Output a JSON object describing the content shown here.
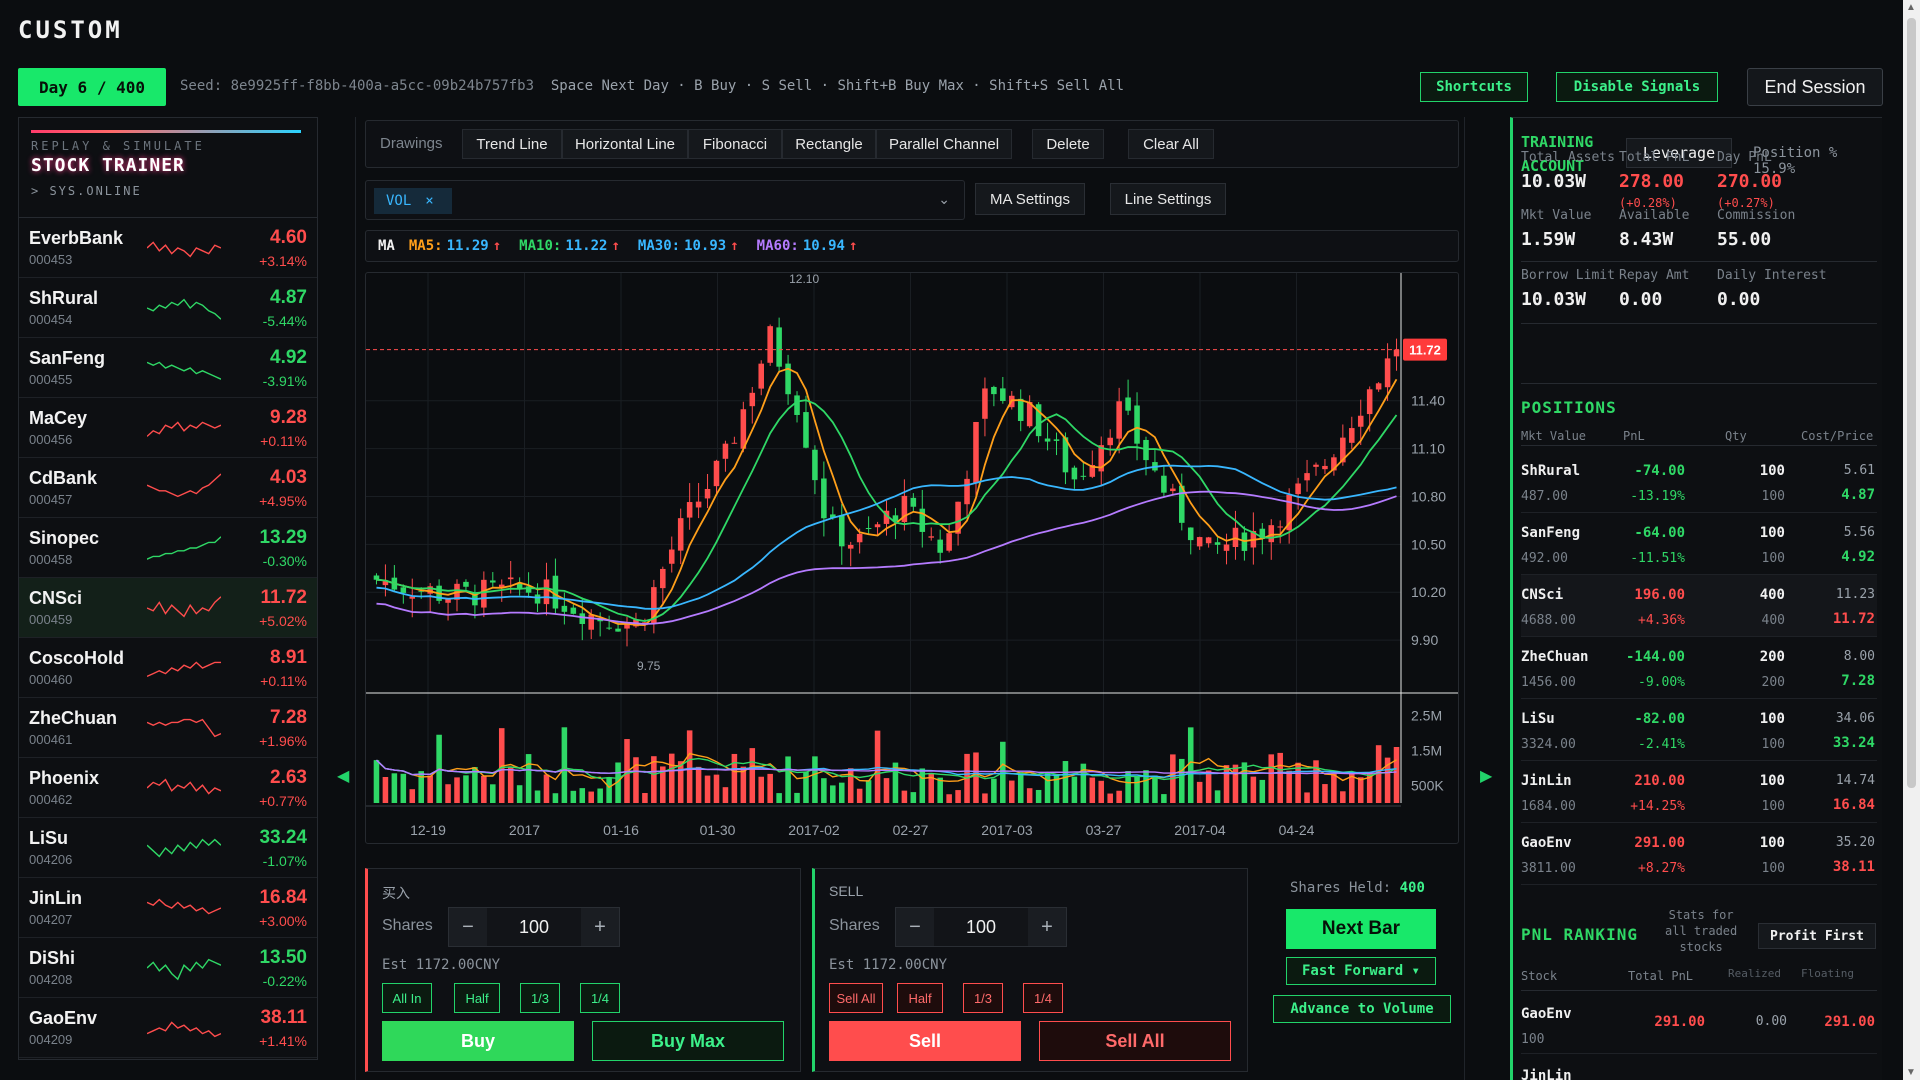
{
  "app": {
    "brand": "CUSTOM",
    "day": "Day 6 / 400",
    "seed": "Seed: 8e9925ff-f8bb-400a-a5cc-09b24b757fb3",
    "hotkeys": "Space Next Day · B Buy · S Sell · Shift+B Buy Max · Shift+S Sell All",
    "shortcuts": "Shortcuts",
    "disable_signals": "Disable Signals",
    "end_session": "End Session"
  },
  "sidebar": {
    "subtitle": "REPLAY & SIMULATE",
    "title": "STOCK TRAINER",
    "status": "> SYS.ONLINE",
    "stocks": [
      {
        "name": "EverbBank",
        "code": "000453",
        "price": "4.60",
        "change": "+3.14%",
        "dir": "up",
        "spark": [
          0.5,
          0.3,
          0.6,
          0.4,
          0.7,
          0.5,
          0.6,
          0.8,
          0.5,
          0.6,
          0.7,
          0.4,
          0.5
        ]
      },
      {
        "name": "ShRural",
        "code": "000454",
        "price": "4.87",
        "change": "-5.44%",
        "dir": "dn",
        "spark": [
          0.5,
          0.6,
          0.4,
          0.5,
          0.3,
          0.4,
          0.2,
          0.5,
          0.3,
          0.4,
          0.6,
          0.7,
          0.9
        ]
      },
      {
        "name": "SanFeng",
        "code": "000455",
        "price": "4.92",
        "change": "-3.91%",
        "dir": "dn",
        "spark": [
          0.3,
          0.4,
          0.3,
          0.5,
          0.4,
          0.5,
          0.6,
          0.5,
          0.7,
          0.6,
          0.7,
          0.8,
          0.9
        ]
      },
      {
        "name": "MaCey",
        "code": "000456",
        "price": "9.28",
        "change": "+0.11%",
        "dir": "up",
        "spark": [
          0.8,
          0.6,
          0.7,
          0.4,
          0.5,
          0.3,
          0.6,
          0.4,
          0.5,
          0.3,
          0.4,
          0.5,
          0.4
        ]
      },
      {
        "name": "CdBank",
        "code": "000457",
        "price": "4.03",
        "change": "+4.95%",
        "dir": "up",
        "spark": [
          0.4,
          0.5,
          0.6,
          0.6,
          0.7,
          0.8,
          0.7,
          0.6,
          0.7,
          0.5,
          0.4,
          0.2,
          0.0
        ]
      },
      {
        "name": "Sinopec",
        "code": "000458",
        "price": "13.29",
        "change": "-0.30%",
        "dir": "dn",
        "spark": [
          0.9,
          0.8,
          0.8,
          0.7,
          0.7,
          0.6,
          0.6,
          0.5,
          0.5,
          0.4,
          0.3,
          0.3,
          0.1
        ]
      },
      {
        "name": "CNSci",
        "code": "000459",
        "price": "11.72",
        "change": "+5.02%",
        "dir": "up",
        "spark": [
          0.5,
          0.6,
          0.3,
          0.7,
          0.4,
          0.6,
          0.8,
          0.4,
          0.7,
          0.5,
          0.6,
          0.3,
          0.1
        ]
      },
      {
        "name": "CoscoHold",
        "code": "000460",
        "price": "8.91",
        "change": "+0.11%",
        "dir": "up",
        "spark": [
          0.8,
          0.7,
          0.6,
          0.7,
          0.5,
          0.6,
          0.4,
          0.5,
          0.3,
          0.5,
          0.4,
          0.3,
          0.3
        ]
      },
      {
        "name": "ZheChuan",
        "code": "000461",
        "price": "7.28",
        "change": "+1.96%",
        "dir": "up",
        "spark": [
          0.3,
          0.4,
          0.3,
          0.4,
          0.3,
          0.3,
          0.2,
          0.2,
          0.3,
          0.2,
          0.5,
          0.8,
          0.7
        ]
      },
      {
        "name": "Phoenix",
        "code": "000462",
        "price": "2.63",
        "change": "+0.77%",
        "dir": "up",
        "spark": [
          0.5,
          0.3,
          0.4,
          0.2,
          0.6,
          0.4,
          0.5,
          0.3,
          0.6,
          0.4,
          0.7,
          0.5,
          0.6
        ]
      },
      {
        "name": "LiSu",
        "code": "004206",
        "price": "33.24",
        "change": "-1.07%",
        "dir": "dn",
        "spark": [
          0.4,
          0.6,
          0.8,
          0.5,
          0.7,
          0.4,
          0.6,
          0.3,
          0.5,
          0.2,
          0.4,
          0.2,
          0.4
        ]
      },
      {
        "name": "JinLin",
        "code": "004207",
        "price": "16.84",
        "change": "+3.00%",
        "dir": "up",
        "spark": [
          0.3,
          0.4,
          0.2,
          0.4,
          0.5,
          0.3,
          0.5,
          0.4,
          0.6,
          0.5,
          0.7,
          0.6,
          0.5
        ]
      },
      {
        "name": "DiShi",
        "code": "004208",
        "price": "13.50",
        "change": "-0.22%",
        "dir": "dn",
        "spark": [
          0.5,
          0.3,
          0.6,
          0.4,
          0.7,
          0.9,
          0.4,
          0.6,
          0.3,
          0.5,
          0.2,
          0.3,
          0.4
        ]
      },
      {
        "name": "GaoEnv",
        "code": "004209",
        "price": "38.11",
        "change": "+1.41%",
        "dir": "up",
        "spark": [
          0.7,
          0.6,
          0.5,
          0.6,
          0.3,
          0.5,
          0.4,
          0.6,
          0.5,
          0.7,
          0.6,
          0.8,
          0.7
        ]
      }
    ]
  },
  "toolbar": {
    "label": "Drawings",
    "buttons": [
      "Trend Line",
      "Horizontal Line",
      "Fibonacci",
      "Rectangle",
      "Parallel Channel",
      "Delete",
      "Clear All"
    ]
  },
  "indicators": {
    "chip": "VOL",
    "chip_close": "×",
    "ma_settings": "MA Settings",
    "line_settings": "Line Settings"
  },
  "ma_legend": {
    "label": "MA",
    "items": [
      {
        "name": "MA5:",
        "value": "11.29",
        "arrow": "↑",
        "color": "#ff9f1a"
      },
      {
        "name": "MA10:",
        "value": "11.22",
        "arrow": "↑",
        "color": "#2fd866"
      },
      {
        "name": "MA30:",
        "value": "10.93",
        "arrow": "↑",
        "color": "#39b7ff"
      },
      {
        "name": "MA60:",
        "value": "10.94",
        "arrow": "↑",
        "color": "#b57bff"
      }
    ]
  },
  "chart_data": {
    "type": "candlestick",
    "price_axis": {
      "ticks": [
        "11.40",
        "11.10",
        "10.80",
        "10.50",
        "10.20",
        "9.90"
      ],
      "range": [
        9.6,
        12.2
      ]
    },
    "current_price": "11.72",
    "high_label": "12.10",
    "low_label": "9.75",
    "volume_axis": {
      "ticks": [
        "2.5M",
        "1.5M",
        "500K"
      ],
      "max": 3.0
    },
    "x_labels": [
      "12-19",
      "2017",
      "01-16",
      "01-30",
      "2017-02",
      "02-27",
      "2017-03",
      "03-27",
      "2017-04",
      "04-24"
    ],
    "colors": {
      "up": "#ff4d4d",
      "down": "#2fd866",
      "ma5": "#ff9f1a",
      "ma10": "#2fd866",
      "ma30": "#39b7ff",
      "ma60": "#b57bff"
    }
  },
  "buy": {
    "title": "买入",
    "shares_label": "Shares",
    "shares": "100",
    "minus": "−",
    "plus": "+",
    "est": "Est 1172.00CNY",
    "quick": [
      "All In",
      "Half",
      "1/3",
      "1/4"
    ],
    "main": "Buy",
    "max": "Buy Max"
  },
  "sell": {
    "title": "SELL",
    "shares_label": "Shares",
    "shares": "100",
    "minus": "−",
    "plus": "+",
    "est": "Est 1172.00CNY",
    "quick": [
      "Sell All",
      "Half",
      "1/3",
      "1/4"
    ],
    "main": "Sell",
    "all": "Sell All"
  },
  "controls": {
    "shares_held_label": "Shares Held:",
    "shares_held": "400",
    "next_bar": "Next Bar",
    "fast_forward": "Fast Forward ▾",
    "advance": "Advance to Volume"
  },
  "account": {
    "title1": "TRAINING",
    "title2": "ACCOUNT",
    "leverage": "Leverage",
    "position_pct": "Position % 15.9%",
    "stats": [
      {
        "label": "Total Assets",
        "value": "10.03W",
        "sub": "",
        "color": "#f0f0f0"
      },
      {
        "label": "Total PnL",
        "value": "278.00",
        "sub": "(+0.28%)",
        "color": "#ff4d4d"
      },
      {
        "label": "Day PnL",
        "value": "270.00",
        "sub": "(+0.27%)",
        "color": "#ff4d4d"
      },
      {
        "label": "Mkt Value",
        "value": "1.59W",
        "sub": "",
        "color": "#f0f0f0"
      },
      {
        "label": "Available",
        "value": "8.43W",
        "sub": "",
        "color": "#f0f0f0"
      },
      {
        "label": "Commission",
        "value": "55.00",
        "sub": "",
        "color": "#f0f0f0"
      },
      {
        "label": "Borrow Limit",
        "value": "10.03W",
        "sub": "",
        "color": "#f0f0f0"
      },
      {
        "label": "Repay Amt",
        "value": "0.00",
        "sub": "",
        "color": "#f0f0f0"
      },
      {
        "label": "Daily Interest",
        "value": "0.00",
        "sub": "",
        "color": "#f0f0f0"
      }
    ]
  },
  "positions": {
    "title": "POSITIONS",
    "headers": [
      "Mkt Value",
      "PnL",
      "Qty",
      "Cost/Price"
    ],
    "rows": [
      {
        "name": "ShRural",
        "mv": "487.00",
        "pnl": "-74.00",
        "pct": "-13.19%",
        "qty": "100",
        "qty2": "100",
        "cost": "5.61",
        "price": "4.87",
        "dir": "dn"
      },
      {
        "name": "SanFeng",
        "mv": "492.00",
        "pnl": "-64.00",
        "pct": "-11.51%",
        "qty": "100",
        "qty2": "100",
        "cost": "5.56",
        "price": "4.92",
        "dir": "dn"
      },
      {
        "name": "CNSci",
        "mv": "4688.00",
        "pnl": "196.00",
        "pct": "+4.36%",
        "qty": "400",
        "qty2": "400",
        "cost": "11.23",
        "price": "11.72",
        "dir": "up"
      },
      {
        "name": "ZheChuan",
        "mv": "1456.00",
        "pnl": "-144.00",
        "pct": "-9.00%",
        "qty": "200",
        "qty2": "200",
        "cost": "8.00",
        "price": "7.28",
        "dir": "dn"
      },
      {
        "name": "LiSu",
        "mv": "3324.00",
        "pnl": "-82.00",
        "pct": "-2.41%",
        "qty": "100",
        "qty2": "100",
        "cost": "34.06",
        "price": "33.24",
        "dir": "dn"
      },
      {
        "name": "JinLin",
        "mv": "1684.00",
        "pnl": "210.00",
        "pct": "+14.25%",
        "qty": "100",
        "qty2": "100",
        "cost": "14.74",
        "price": "16.84",
        "dir": "up"
      },
      {
        "name": "GaoEnv",
        "mv": "3811.00",
        "pnl": "291.00",
        "pct": "+8.27%",
        "qty": "100",
        "qty2": "100",
        "cost": "35.20",
        "price": "38.11",
        "dir": "up"
      }
    ]
  },
  "ranking": {
    "title": "PNL RANKING",
    "note1": "Stats for",
    "note2": "all traded",
    "note3": "stocks",
    "sort": "Profit First",
    "headers": [
      "Stock",
      "Total PnL",
      "Realized",
      "Floating"
    ],
    "rows": [
      {
        "name": "GaoEnv",
        "qty": "100",
        "total": "291.00",
        "realized": "0.00",
        "floating": "291.00"
      },
      {
        "name": "JinLin",
        "qty": "",
        "total": "",
        "realized": "",
        "floating": ""
      }
    ]
  }
}
